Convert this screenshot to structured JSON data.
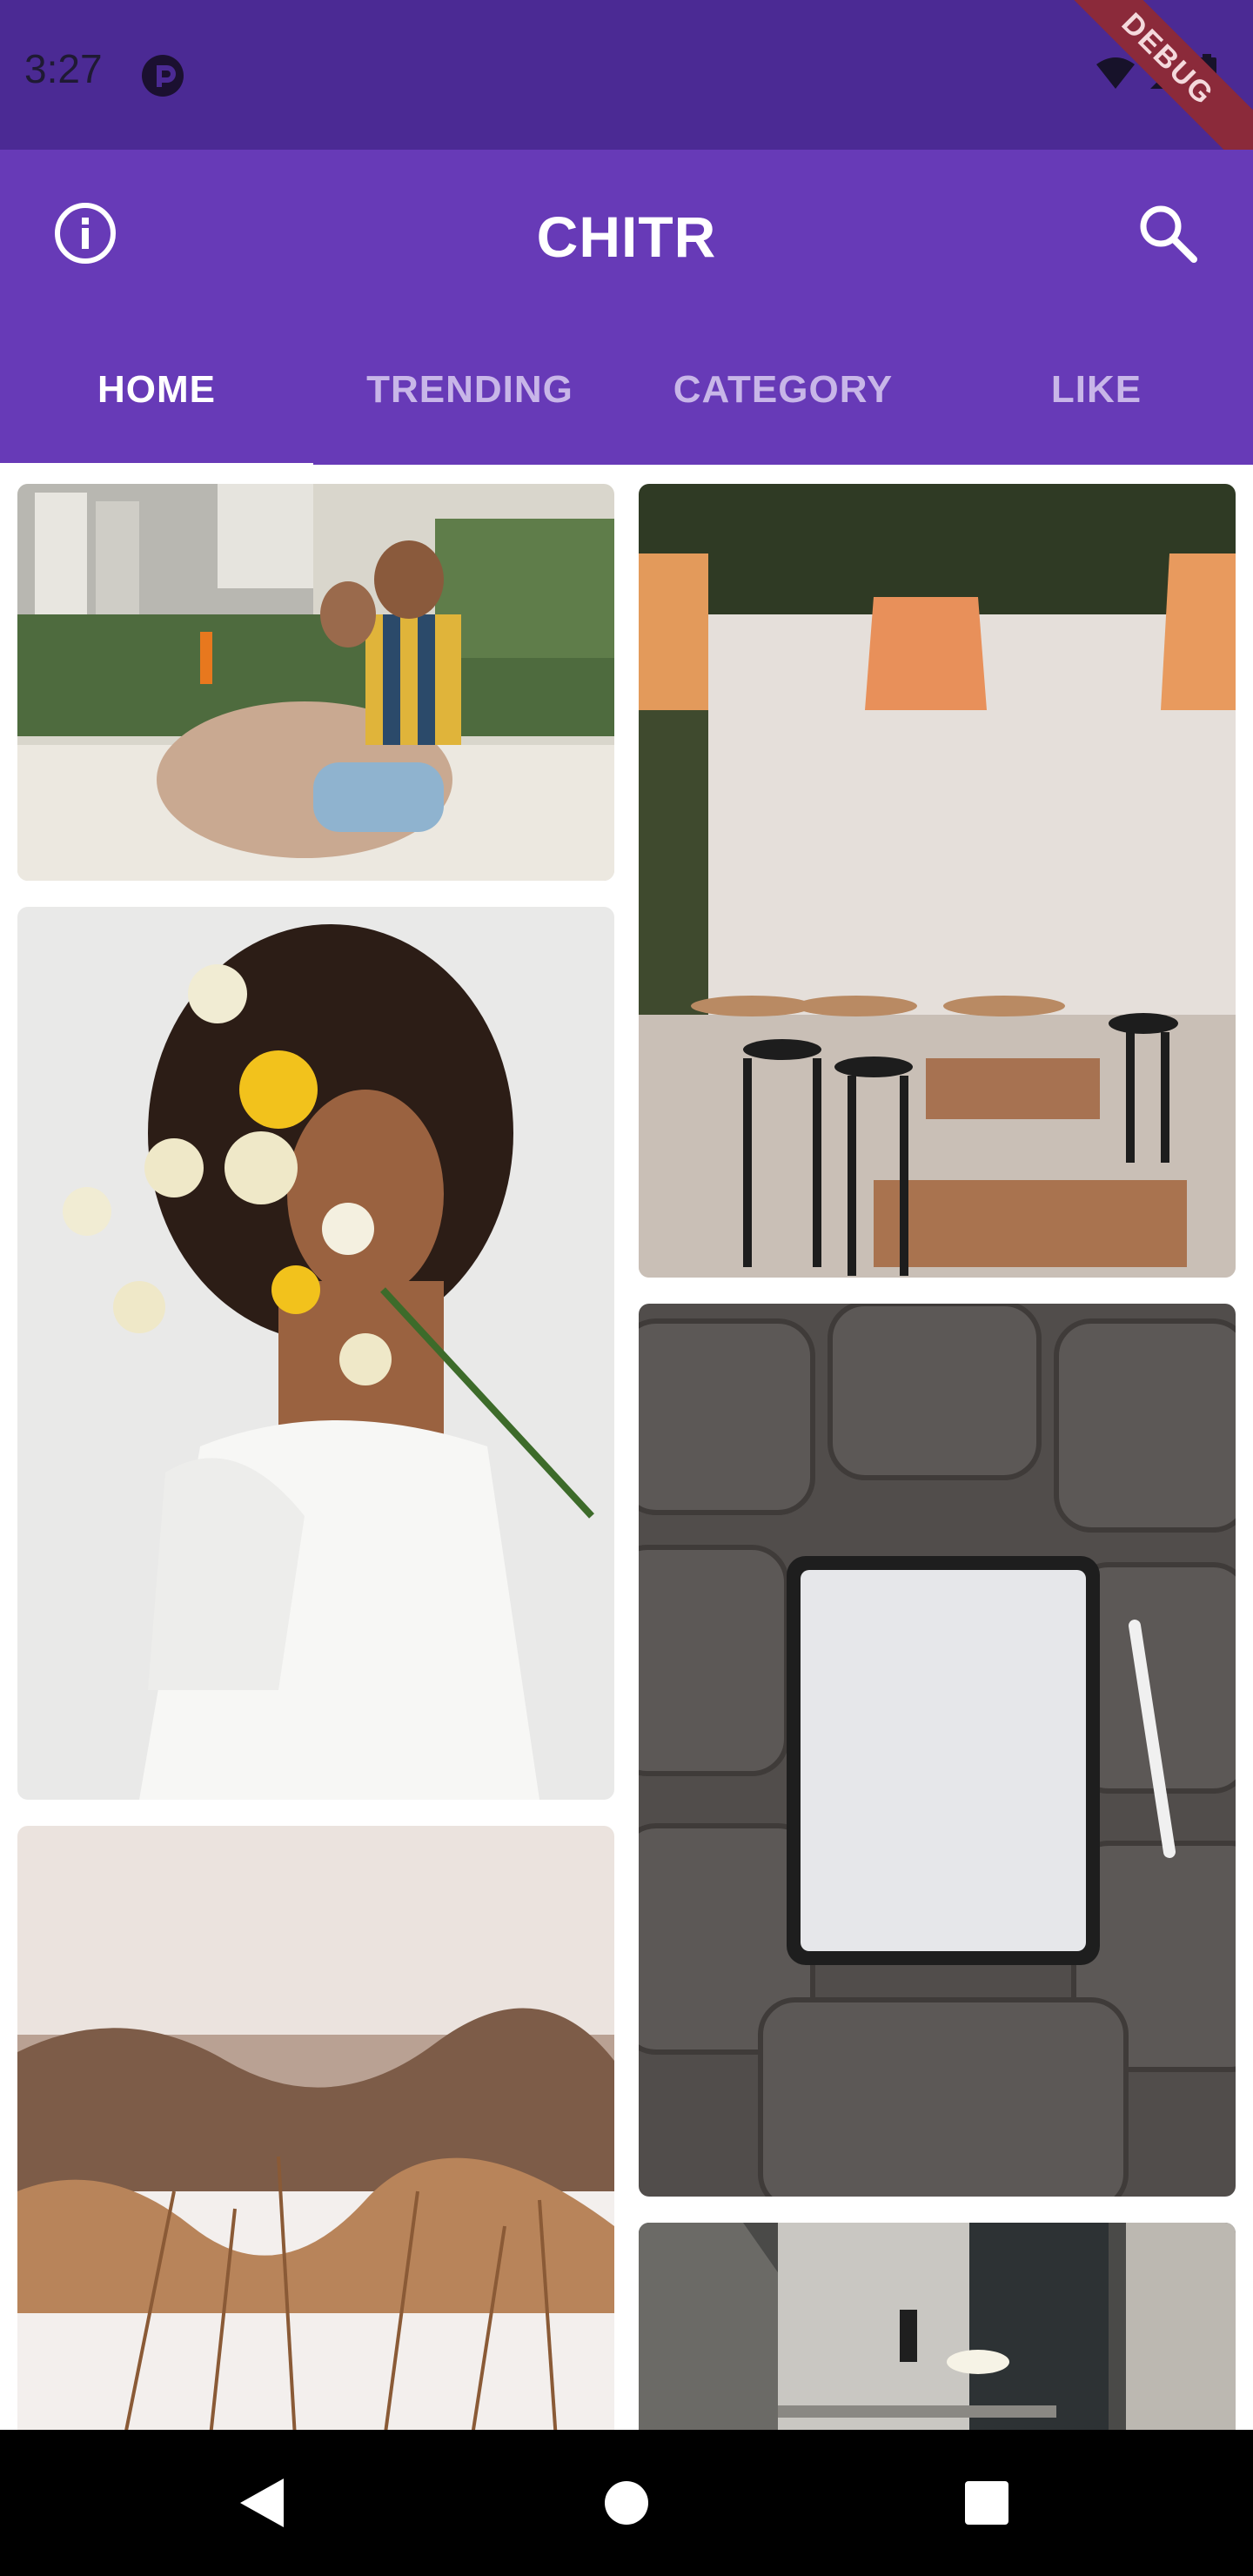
{
  "status_bar": {
    "time": "3:27",
    "app_icon": "pocket-casts-icon",
    "right_icons": [
      "wifi-icon",
      "signal-icon",
      "battery-icon"
    ],
    "debug_label": "DEBUG"
  },
  "app_bar": {
    "title": "CHITR",
    "left_icon": "info-icon",
    "right_icon": "search-icon",
    "tabs": [
      {
        "label": "HOME",
        "active": true
      },
      {
        "label": "TRENDING",
        "active": false
      },
      {
        "label": "CATEGORY",
        "active": false
      },
      {
        "label": "LIKE",
        "active": false
      }
    ]
  },
  "grid": {
    "images": [
      {
        "name": "couple-on-beach-image"
      },
      {
        "name": "woman-with-flowers-image"
      },
      {
        "name": "snowy-field-image"
      },
      {
        "name": "cafe-with-lamps-image"
      },
      {
        "name": "tablet-on-cushion-image"
      },
      {
        "name": "ceiling-light-image"
      }
    ]
  },
  "nav_bar": {
    "icons": [
      "back-icon",
      "home-icon",
      "recents-icon"
    ]
  },
  "colors": {
    "status_bar": "#4b2a94",
    "primary": "#673ab7",
    "tab_inactive": "#c8b6e8",
    "tab_active": "#ffffff"
  }
}
